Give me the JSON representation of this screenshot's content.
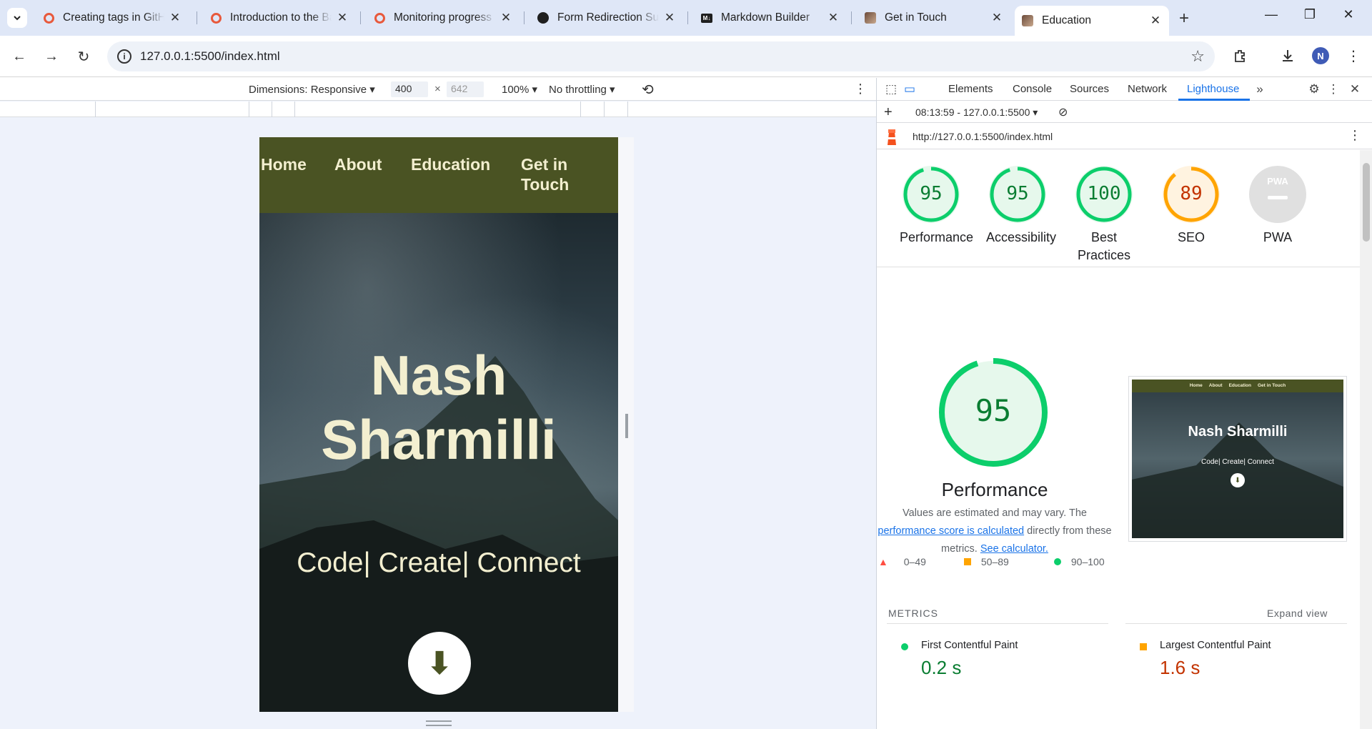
{
  "tabs": [
    {
      "title": "Creating tags in GitHub",
      "favicon": "ring-icon"
    },
    {
      "title": "Introduction to the Basics",
      "favicon": "ring-icon"
    },
    {
      "title": "Monitoring progress",
      "favicon": "ring-icon"
    },
    {
      "title": "Form Redirection Success",
      "favicon": "openai-icon"
    },
    {
      "title": "Markdown Builder",
      "favicon": "markdown-icon"
    },
    {
      "title": "Get in Touch",
      "favicon": "portrait-icon"
    },
    {
      "title": "Education",
      "favicon": "portrait-icon",
      "active": true
    }
  ],
  "addressbar": {
    "url": "127.0.0.1:5500/index.html",
    "profile_initial": "N"
  },
  "device_toolbar": {
    "dimensions_label": "Dimensions: Responsive",
    "width": "400",
    "height": "642",
    "zoom": "100%",
    "throttle": "No throttling"
  },
  "site": {
    "nav": [
      "Home",
      "About",
      "Education",
      "Get in Touch"
    ],
    "name_line1": "Nash",
    "name_line2": "Sharmilli",
    "tagline": "Code| Create| Connect",
    "download_glyph": "⬇"
  },
  "devtools": {
    "tabs": [
      "Elements",
      "Console",
      "Sources",
      "Network",
      "Lighthouse"
    ],
    "active_tab": "Lighthouse",
    "report_time": "08:13:59 - 127.0.0.1:5500",
    "report_url": "http://127.0.0.1:5500/index.html"
  },
  "lighthouse": {
    "scores": [
      {
        "label": "Performance",
        "value": 95,
        "color": "#0cce6b",
        "text": "#0a7d32"
      },
      {
        "label": "Accessibility",
        "value": 95,
        "color": "#0cce6b",
        "text": "#0a7d32"
      },
      {
        "label": "Best Practices",
        "value": 100,
        "color": "#0cce6b",
        "text": "#0a7d32"
      },
      {
        "label": "SEO",
        "value": 89,
        "color": "#ffa400",
        "text": "#c33300"
      },
      {
        "label": "PWA",
        "value": null,
        "color": "#dadada",
        "text": "#9e9e9e"
      }
    ],
    "pwa_badge": "PWA",
    "perf_big": "95",
    "perf_title": "Performance",
    "desc_prefix": "Values are estimated and may vary. The ",
    "desc_link": "performance score is calculated",
    "desc_middle": " directly from these metrics. ",
    "desc_link2": "See calculator.",
    "legend": [
      "0–49",
      "50–89",
      "90–100"
    ],
    "thumb": {
      "nav": [
        "Home",
        "About",
        "Education",
        "Get in Touch"
      ],
      "name": "Nash Sharmilli",
      "tagline": "Code| Create| Connect"
    },
    "metrics_header": "METRICS",
    "expand_view": "Expand view",
    "metrics": [
      {
        "name": "First Contentful Paint",
        "value": "0.2 s",
        "status": "pass",
        "color": "#0cce6b",
        "text": "#0a7d32"
      },
      {
        "name": "Largest Contentful Paint",
        "value": "1.6 s",
        "status": "average",
        "color": "#ffa400",
        "text": "#c33300"
      }
    ]
  }
}
